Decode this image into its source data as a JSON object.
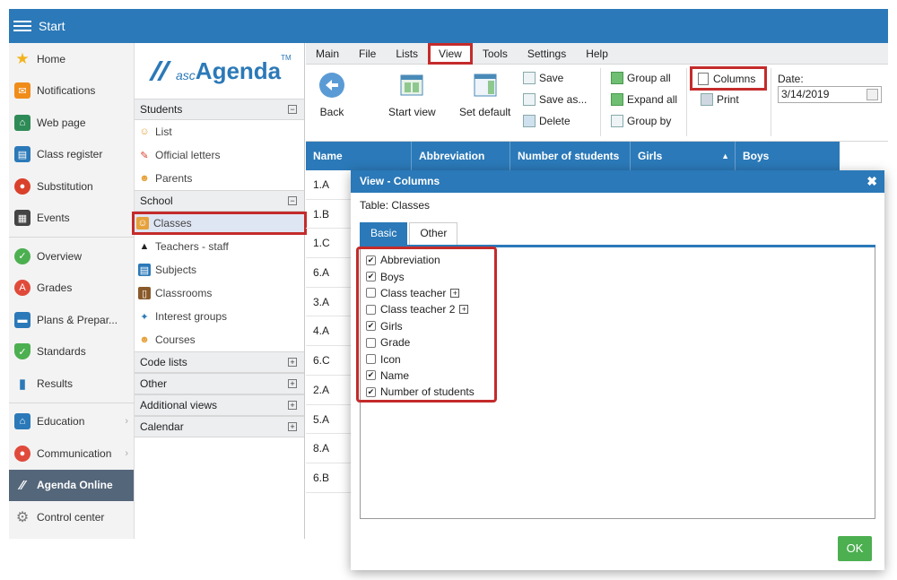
{
  "topbar": {
    "title": "Start"
  },
  "leftnav": {
    "items": [
      {
        "label": "Home",
        "icon": "star-icon",
        "color": "#f3b31b"
      },
      {
        "label": "Notifications",
        "icon": "envelope-icon",
        "color": "#f08c1a"
      },
      {
        "label": "Web page",
        "icon": "house-icon",
        "color": "#2e8b57"
      },
      {
        "label": "Class register",
        "icon": "register-icon",
        "color": "#2b79b8"
      },
      {
        "label": "Substitution",
        "icon": "substitution-icon",
        "color": "#d9412b"
      },
      {
        "label": "Events",
        "icon": "calendar-icon",
        "color": "#444444"
      },
      {
        "label": "Overview",
        "icon": "check-circle-icon",
        "color": "#4caf50"
      },
      {
        "label": "Grades",
        "icon": "grades-icon",
        "color": "#e04a3a"
      },
      {
        "label": "Plans & Prepar...",
        "icon": "briefcase-icon",
        "color": "#2b79b8"
      },
      {
        "label": "Standards",
        "icon": "shield-icon",
        "color": "#4caf50"
      },
      {
        "label": "Results",
        "icon": "bar-chart-icon",
        "color": "#2b79b8"
      },
      {
        "label": "Education",
        "icon": "school-icon",
        "color": "#2b79b8"
      },
      {
        "label": "Communication",
        "icon": "chat-icon",
        "color": "#e04a3a"
      },
      {
        "label": "Agenda Online",
        "icon": "agenda-icon",
        "color": "#ffffff"
      },
      {
        "label": "Control center",
        "icon": "gear-icon",
        "color": "#777777"
      }
    ]
  },
  "midpanel": {
    "logo": {
      "prefix": "asc",
      "name": "Agenda",
      "tm": "TM"
    },
    "students": {
      "header": "Students",
      "items": [
        {
          "label": "List"
        },
        {
          "label": "Official letters"
        },
        {
          "label": "Parents"
        }
      ]
    },
    "school": {
      "header": "School",
      "items": [
        {
          "label": "Classes"
        },
        {
          "label": "Teachers - staff"
        },
        {
          "label": "Subjects"
        },
        {
          "label": "Classrooms"
        },
        {
          "label": "Interest groups"
        },
        {
          "label": "Courses"
        }
      ]
    },
    "collapsed": [
      {
        "label": "Code lists"
      },
      {
        "label": "Other"
      },
      {
        "label": "Additional views"
      },
      {
        "label": "Calendar"
      }
    ],
    "collapse_sign": "−",
    "expand_sign": "+"
  },
  "menubar": {
    "items": [
      "Main",
      "File",
      "Lists",
      "View",
      "Tools",
      "Settings",
      "Help"
    ]
  },
  "toolbar": {
    "back": "Back",
    "start_view": "Start view",
    "set_default": "Set default",
    "save": "Save",
    "save_as": "Save as...",
    "delete": "Delete",
    "group_all": "Group all",
    "expand_all": "Expand all",
    "group_by": "Group by",
    "columns": "Columns",
    "print": "Print",
    "date_label": "Date:",
    "date_value": "3/14/2019"
  },
  "table": {
    "headers": [
      "Name",
      "Abbreviation",
      "Number of students",
      "Girls",
      "Boys"
    ],
    "sort_indicator": "▲",
    "rows": [
      "1.A",
      "1.B",
      "1.C",
      "6.A",
      "3.A",
      "4.A",
      "6.C",
      "2.A",
      "5.A",
      "8.A",
      "6.B"
    ]
  },
  "dialog": {
    "title": "View - Columns",
    "close": "✖",
    "table_label": "Table: Classes",
    "tabs": [
      "Basic",
      "Other"
    ],
    "columns": [
      {
        "label": "Abbreviation",
        "checked": true,
        "expandable": false
      },
      {
        "label": "Boys",
        "checked": true,
        "expandable": false
      },
      {
        "label": "Class teacher",
        "checked": false,
        "expandable": true
      },
      {
        "label": "Class teacher 2",
        "checked": false,
        "expandable": true
      },
      {
        "label": "Girls",
        "checked": true,
        "expandable": false
      },
      {
        "label": "Grade",
        "checked": false,
        "expandable": false
      },
      {
        "label": "Icon",
        "checked": false,
        "expandable": false
      },
      {
        "label": "Name",
        "checked": true,
        "expandable": false
      },
      {
        "label": "Number of students",
        "checked": true,
        "expandable": false
      }
    ],
    "ok": "OK"
  },
  "colors": {
    "accent": "#2b79b8",
    "highlight": "#c42b2b",
    "ok": "#4caf50",
    "nav_active": "#54667a"
  }
}
